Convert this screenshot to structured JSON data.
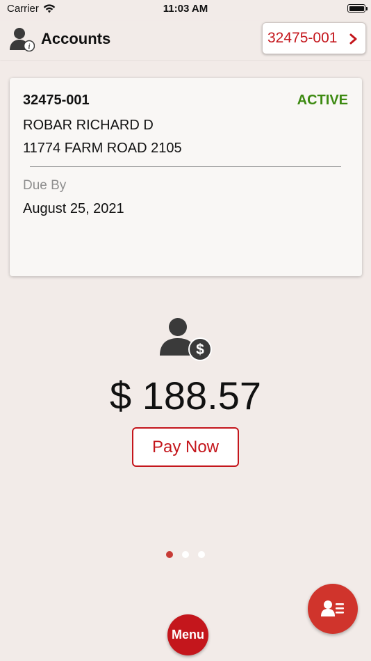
{
  "status_bar": {
    "carrier": "Carrier",
    "time": "11:03 AM",
    "wifi_icon": "wifi-icon",
    "battery_icon": "battery-icon"
  },
  "header": {
    "icon": "account-info-icon",
    "title": "Accounts",
    "account_selector": {
      "label": "32475-001",
      "icon": "chevron-right-icon"
    }
  },
  "account_card": {
    "account_number": "32475-001",
    "status": "ACTIVE",
    "name": "ROBAR RICHARD D",
    "address": "11774 FARM ROAD 2105",
    "due_label": "Due By",
    "due_date": "August 25, 2021"
  },
  "balance": {
    "icon": "user-dollar-icon",
    "amount": "$ 188.57",
    "pay_button_label": "Pay Now"
  },
  "pager": {
    "count": 3,
    "active_index": 0
  },
  "fab": {
    "icon": "contact-card-icon"
  },
  "menu_button": {
    "label": "Menu"
  },
  "colors": {
    "accent": "#c4161c",
    "status_active": "#3d8a11",
    "background": "#f2ebe8",
    "card_background": "#f9f7f5",
    "secondary_text": "#8e8e8e"
  }
}
